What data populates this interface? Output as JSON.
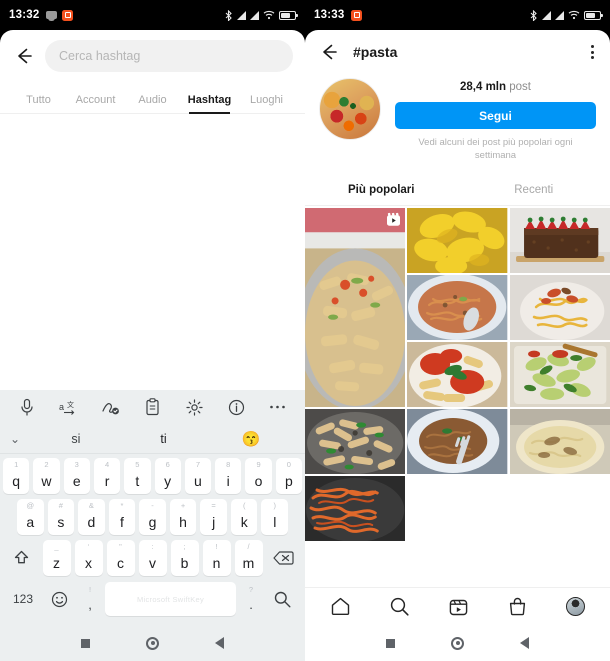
{
  "left_phone": {
    "status_bar": {
      "time": "13:32",
      "icons": [
        "message-icon",
        "app-icon",
        "bluetooth-icon",
        "signal-icon",
        "signal-icon",
        "wifi-icon",
        "battery-icon"
      ]
    },
    "search_header": {
      "back_icon": "back-arrow-icon",
      "placeholder": "Cerca hashtag",
      "value": ""
    },
    "tabs": [
      {
        "label": "Tutto",
        "active": false
      },
      {
        "label": "Account",
        "active": false
      },
      {
        "label": "Audio",
        "active": false
      },
      {
        "label": "Hashtag",
        "active": true
      },
      {
        "label": "Luoghi",
        "active": false
      }
    ],
    "keyboard": {
      "toolbar_icons": [
        "microphone-icon",
        "translate-icon",
        "handwriting-icon",
        "clipboard-icon",
        "gear-icon",
        "info-icon",
        "more-icon"
      ],
      "suggestions": {
        "expand": "⌄",
        "items": [
          "si",
          "ti"
        ],
        "emoji": "😙"
      },
      "row1": [
        {
          "key": "q",
          "hint": "1"
        },
        {
          "key": "w",
          "hint": "2"
        },
        {
          "key": "e",
          "hint": "3"
        },
        {
          "key": "r",
          "hint": "4"
        },
        {
          "key": "t",
          "hint": "5"
        },
        {
          "key": "y",
          "hint": "6"
        },
        {
          "key": "u",
          "hint": "7"
        },
        {
          "key": "i",
          "hint": "8"
        },
        {
          "key": "o",
          "hint": "9"
        },
        {
          "key": "p",
          "hint": "0"
        }
      ],
      "row2": [
        {
          "key": "a",
          "hint": "@"
        },
        {
          "key": "s",
          "hint": "#"
        },
        {
          "key": "d",
          "hint": "&"
        },
        {
          "key": "f",
          "hint": "*"
        },
        {
          "key": "g",
          "hint": "-"
        },
        {
          "key": "h",
          "hint": "+"
        },
        {
          "key": "j",
          "hint": "="
        },
        {
          "key": "k",
          "hint": "("
        },
        {
          "key": "l",
          "hint": ")"
        }
      ],
      "row3": [
        {
          "key": "z",
          "hint": "_"
        },
        {
          "key": "x",
          "hint": "‘"
        },
        {
          "key": "c",
          "hint": "\""
        },
        {
          "key": "v",
          "hint": ":"
        },
        {
          "key": "b",
          "hint": ";"
        },
        {
          "key": "n",
          "hint": "!"
        },
        {
          "key": "m",
          "hint": "/"
        }
      ],
      "shift_icon": "shift-icon",
      "backspace_icon": "backspace-icon",
      "numeric_label": "123",
      "emoji_icon": "emoji-icon",
      "comma": ",",
      "period": ".",
      "space_label": "Microsoft SwiftKey",
      "search_icon": "search-icon"
    },
    "android_nav": [
      "recents-icon",
      "home-icon",
      "back-icon"
    ]
  },
  "right_phone": {
    "status_bar": {
      "time": "13:33",
      "icons": [
        "app-icon",
        "bluetooth-icon",
        "signal-icon",
        "signal-icon",
        "wifi-icon",
        "battery-icon"
      ]
    },
    "header": {
      "back_icon": "back-arrow-icon",
      "title": "#pasta",
      "menu_icon": "more-options-icon"
    },
    "profile": {
      "avatar": "hashtag-avatar",
      "post_count": "28,4 mln",
      "post_label": "post",
      "follow_label": "Segui",
      "description": "Vedi alcuni dei post più popolari ogni settimana",
      "accent_color": "#0095f6"
    },
    "content_tabs": [
      {
        "label": "Più popolari",
        "active": true
      },
      {
        "label": "Recenti",
        "active": false
      }
    ],
    "grid": [
      {
        "name": "post-penne-pan",
        "tall": true,
        "badge": "reels-icon"
      },
      {
        "name": "post-yellow-pasta",
        "tall": false,
        "badge": ""
      },
      {
        "name": "post-chocolate-cake",
        "tall": false,
        "badge": ""
      },
      {
        "name": "post-noodles-bowl",
        "tall": false,
        "badge": ""
      },
      {
        "name": "post-carbonara",
        "tall": false,
        "badge": ""
      },
      {
        "name": "post-tomato-pasta",
        "tall": false,
        "badge": ""
      },
      {
        "name": "post-pesto-pasta",
        "tall": false,
        "badge": ""
      },
      {
        "name": "post-casarecce",
        "tall": false,
        "badge": ""
      },
      {
        "name": "post-noodles-fork",
        "tall": false,
        "badge": ""
      },
      {
        "name": "post-cream-pasta",
        "tall": false,
        "badge": ""
      },
      {
        "name": "post-red-spaghetti",
        "tall": false,
        "badge": ""
      }
    ],
    "bottom_nav": [
      "home-icon",
      "search-icon",
      "reels-icon",
      "shop-icon",
      "profile-avatar-icon"
    ],
    "android_nav": [
      "recents-icon",
      "home-icon",
      "back-icon"
    ]
  }
}
